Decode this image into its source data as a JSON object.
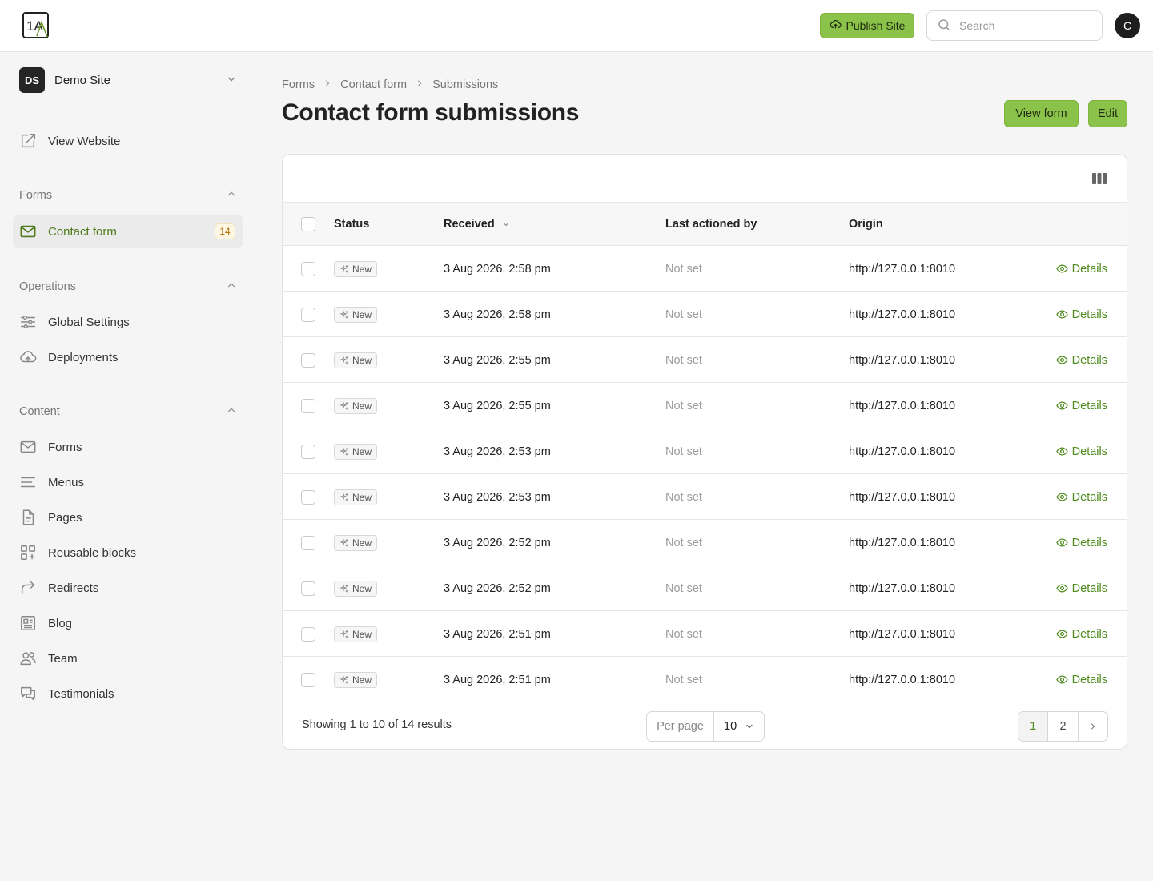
{
  "topbar": {
    "logo_text": "1A",
    "publish_label": "Publish Site",
    "search_placeholder": "Search",
    "user_initial": "C"
  },
  "sidebar": {
    "site": {
      "initials": "DS",
      "name": "Demo Site"
    },
    "view_website": "View Website",
    "groups": {
      "forms": {
        "title": "Forms",
        "items": [
          {
            "label": "Contact form",
            "count": "14"
          }
        ]
      },
      "operations": {
        "title": "Operations",
        "items": [
          {
            "label": "Global Settings"
          },
          {
            "label": "Deployments"
          }
        ]
      },
      "content": {
        "title": "Content",
        "items": [
          {
            "label": "Forms"
          },
          {
            "label": "Menus"
          },
          {
            "label": "Pages"
          },
          {
            "label": "Reusable blocks"
          },
          {
            "label": "Redirects"
          },
          {
            "label": "Blog"
          },
          {
            "label": "Team"
          },
          {
            "label": "Testimonials"
          }
        ]
      }
    }
  },
  "breadcrumb": [
    "Forms",
    "Contact form",
    "Submissions"
  ],
  "page": {
    "title": "Contact form submissions",
    "view_form_label": "View form",
    "edit_label": "Edit"
  },
  "table": {
    "columns": {
      "status": "Status",
      "received": "Received",
      "last_actioned": "Last actioned by",
      "origin": "Origin"
    },
    "rows": [
      {
        "status": "New",
        "received": "3 Aug 2026, 2:58 pm",
        "actioned": "Not set",
        "origin": "http://127.0.0.1:8010",
        "action": "Details"
      },
      {
        "status": "New",
        "received": "3 Aug 2026, 2:58 pm",
        "actioned": "Not set",
        "origin": "http://127.0.0.1:8010",
        "action": "Details"
      },
      {
        "status": "New",
        "received": "3 Aug 2026, 2:55 pm",
        "actioned": "Not set",
        "origin": "http://127.0.0.1:8010",
        "action": "Details"
      },
      {
        "status": "New",
        "received": "3 Aug 2026, 2:55 pm",
        "actioned": "Not set",
        "origin": "http://127.0.0.1:8010",
        "action": "Details"
      },
      {
        "status": "New",
        "received": "3 Aug 2026, 2:53 pm",
        "actioned": "Not set",
        "origin": "http://127.0.0.1:8010",
        "action": "Details"
      },
      {
        "status": "New",
        "received": "3 Aug 2026, 2:53 pm",
        "actioned": "Not set",
        "origin": "http://127.0.0.1:8010",
        "action": "Details"
      },
      {
        "status": "New",
        "received": "3 Aug 2026, 2:52 pm",
        "actioned": "Not set",
        "origin": "http://127.0.0.1:8010",
        "action": "Details"
      },
      {
        "status": "New",
        "received": "3 Aug 2026, 2:52 pm",
        "actioned": "Not set",
        "origin": "http://127.0.0.1:8010",
        "action": "Details"
      },
      {
        "status": "New",
        "received": "3 Aug 2026, 2:51 pm",
        "actioned": "Not set",
        "origin": "http://127.0.0.1:8010",
        "action": "Details"
      },
      {
        "status": "New",
        "received": "3 Aug 2026, 2:51 pm",
        "actioned": "Not set",
        "origin": "http://127.0.0.1:8010",
        "action": "Details"
      }
    ]
  },
  "footer": {
    "showing": "Showing 1 to 10 of 14 results",
    "per_page_label": "Per page",
    "per_page_value": "10",
    "pages": [
      "1",
      "2"
    ]
  },
  "colors": {
    "accent": "#8bc34a",
    "accent_text": "#4e8a1c",
    "badge_bg": "#fdf6e3"
  }
}
